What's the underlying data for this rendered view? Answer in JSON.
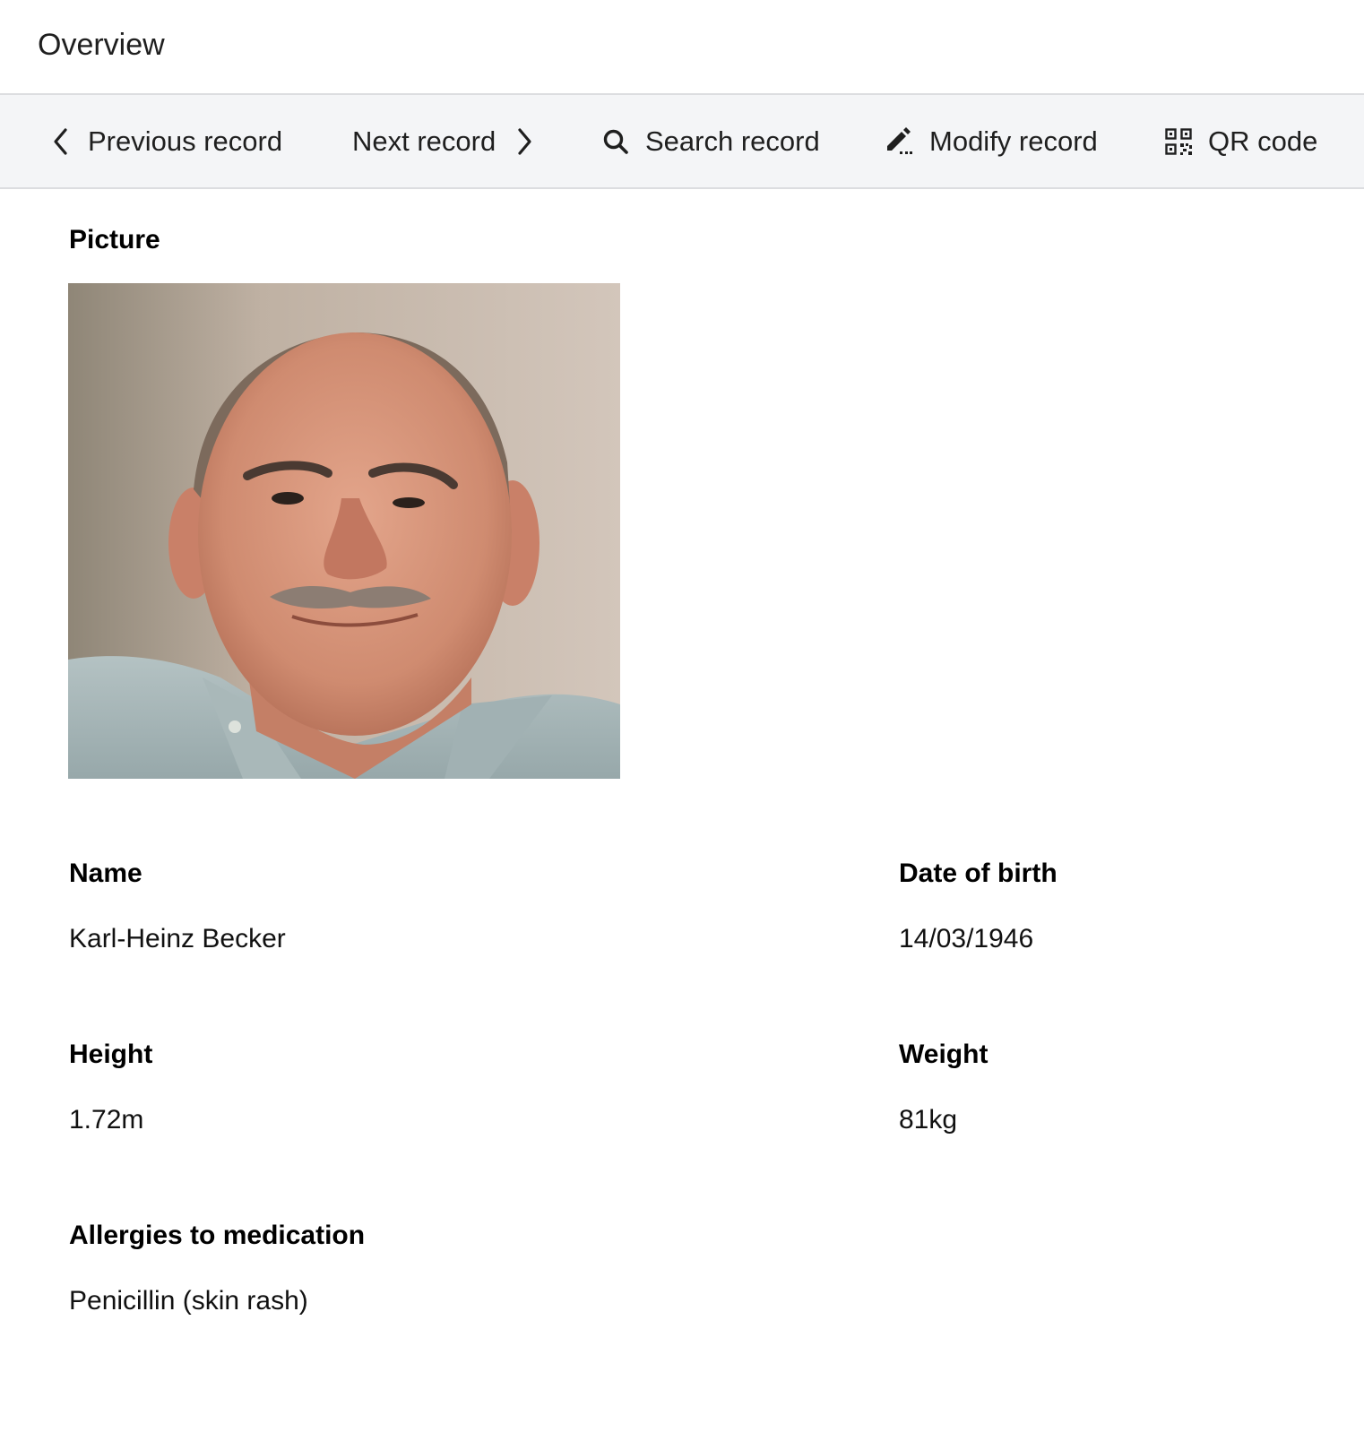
{
  "header": {
    "title": "Overview"
  },
  "toolbar": {
    "previous_label": "Previous record",
    "next_label": "Next record",
    "search_label": "Search record",
    "modify_label": "Modify record",
    "qr_label": "QR code",
    "icons": [
      "chevron-left-icon",
      "chevron-right-icon",
      "search-icon",
      "edit-pencil-icon",
      "qr-code-icon"
    ]
  },
  "record": {
    "picture_label": "Picture",
    "name_label": "Name",
    "name_value": "Karl-Heinz Becker",
    "dob_label": "Date of birth",
    "dob_value": "14/03/1946",
    "height_label": "Height",
    "height_value": "1.72m",
    "weight_label": "Weight",
    "weight_value": "81kg",
    "allergies_label": "Allergies to medication",
    "allergies_value": "Penicillin (skin rash)"
  }
}
